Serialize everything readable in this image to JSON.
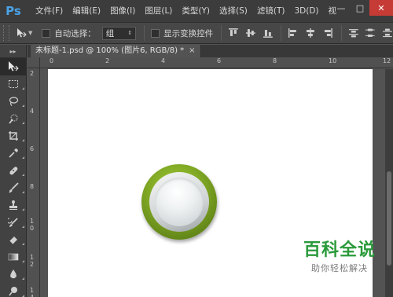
{
  "app": {
    "logo": "Ps"
  },
  "menu": [
    "文件(F)",
    "编辑(E)",
    "图像(I)",
    "图层(L)",
    "类型(Y)",
    "选择(S)",
    "滤镜(T)",
    "3D(D)",
    "视"
  ],
  "window_buttons": {
    "minimize": "—",
    "maximize": "□",
    "close": "✕"
  },
  "options": {
    "auto_select_label": "自动选择：",
    "auto_select_value": "组",
    "show_transform_label": "显示变换控件"
  },
  "document": {
    "tab_title": "未标题-1.psd @ 100% (图片6, RGB/8) *",
    "tab_close": "×"
  },
  "ruler": {
    "h_labels": [
      "0",
      "2",
      "4",
      "6",
      "8",
      "10",
      "12"
    ],
    "v_labels": [
      "2",
      "4",
      "6",
      "8",
      "1\n0",
      "1\n2",
      "1\n4"
    ]
  },
  "watermark": {
    "title": "百科全说",
    "subtitle": "助你轻松解决"
  },
  "colors": {
    "accent": "#4aa3e8",
    "button_green": "#7ea623",
    "watermark_green": "#2a9a3a",
    "close_red": "#c63b35"
  },
  "tools": [
    "move-icon",
    "marquee-icon",
    "lasso-icon",
    "quick-select-icon",
    "crop-icon",
    "eyedropper-icon",
    "healing-icon",
    "brush-icon",
    "stamp-icon",
    "history-brush-icon",
    "eraser-icon",
    "gradient-icon",
    "blur-icon",
    "dodge-icon"
  ]
}
